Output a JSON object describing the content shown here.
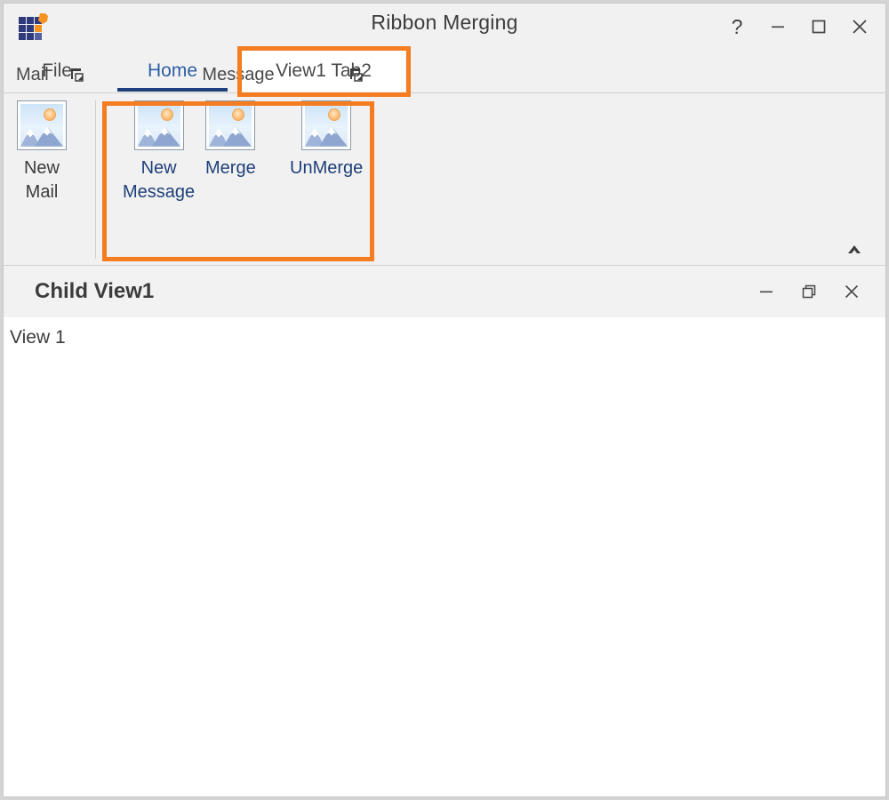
{
  "window": {
    "title": "Ribbon Merging",
    "app_icon": "app-grid-icon",
    "controls": {
      "help": "?",
      "minimize": "minimize-icon",
      "maximize": "maximize-icon",
      "close": "close-icon"
    }
  },
  "tabs": [
    {
      "id": "file",
      "label": "File",
      "active": false
    },
    {
      "id": "home",
      "label": "Home",
      "active": true
    },
    {
      "id": "view1",
      "label": "View1 Tab2",
      "active": false,
      "highlighted": true
    }
  ],
  "ribbon": {
    "collapse_icon": "chevron-up-icon",
    "groups": [
      {
        "id": "mail",
        "label": "Mail",
        "launcher_icon": "dialog-launcher-icon",
        "items": [
          {
            "id": "new-mail",
            "label": "New\nMail",
            "icon": "picture-icon",
            "label_color": "#3c3c3c"
          }
        ]
      },
      {
        "id": "message",
        "label": "Message",
        "launcher_icon": "dialog-launcher-icon",
        "highlighted": true,
        "items": [
          {
            "id": "new-message",
            "label": "New\nMessage",
            "icon": "picture-icon",
            "label_color": "#1f3f7a"
          },
          {
            "id": "merge",
            "label": "Merge",
            "icon": "picture-icon",
            "label_color": "#1f3f7a"
          },
          {
            "id": "unmerge",
            "label": "UnMerge",
            "icon": "picture-icon",
            "label_color": "#1f3f7a"
          }
        ]
      }
    ]
  },
  "child_window": {
    "title": "Child View1",
    "content_text": "View 1",
    "controls": {
      "minimize": "minimize-icon",
      "restore": "restore-icon",
      "close": "close-icon"
    }
  },
  "colors": {
    "accent_blue": "#2e5fa3",
    "active_tab_underline": "#1f3f7a",
    "annotation_orange": "#f57c20",
    "chrome_background": "#f1f1f1",
    "icon_navy": "#303a7a",
    "icon_orange": "#f79420"
  }
}
